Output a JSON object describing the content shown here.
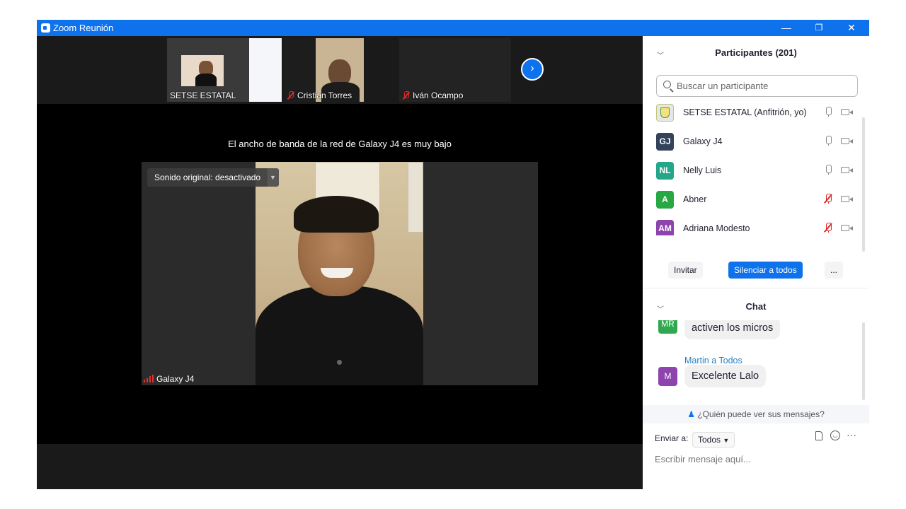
{
  "window": {
    "title": "Zoom Reunión",
    "minimize_glyph": "—",
    "restore_glyph": "❐",
    "close_glyph": "✕"
  },
  "thumbnails": [
    {
      "name": "SETSE ESTATAL",
      "muted": false
    },
    {
      "name": "Cristian Torres",
      "muted": true
    },
    {
      "name": "Iván Ocampo",
      "muted": true
    }
  ],
  "next_arrow": "›",
  "banner": "El ancho de banda de la red de Galaxy J4 es muy bajo",
  "main_video": {
    "sound_button": "Sonido original: desactivado",
    "name": "Galaxy J4"
  },
  "participants": {
    "header": "Participantes (201)",
    "search_placeholder": "Buscar un participante",
    "list": [
      {
        "initials": "",
        "name": "SETSE ESTATAL (Anfitrión, yo)",
        "color": "#e6e6e6",
        "mic_muted": false
      },
      {
        "initials": "GJ",
        "name": "Galaxy J4",
        "color": "#34435a",
        "mic_muted": false
      },
      {
        "initials": "NL",
        "name": "Nelly Luis",
        "color": "#23a78a",
        "mic_muted": false
      },
      {
        "initials": "A",
        "name": "Abner",
        "color": "#28a745",
        "mic_muted": true
      },
      {
        "initials": "AM",
        "name": "Adriana Modesto",
        "color": "#8e44ad",
        "mic_muted": true
      }
    ],
    "invite_label": "Invitar",
    "mute_all_label": "Silenciar a todos",
    "more_label": "..."
  },
  "chat": {
    "header": "Chat",
    "messages": [
      {
        "initials": "MR",
        "color": "#2fa84f",
        "text": "activen los micros"
      },
      {
        "initials": "M",
        "color": "#8e44ad",
        "sender": "Martin a Todos",
        "text": "Excelente Lalo"
      }
    ],
    "privacy_note": "¿Quién puede ver sus mensajes?",
    "send_to_label": "Enviar a:",
    "send_to_value": "Todos",
    "compose_placeholder": "Escribir mensaje aquí..."
  },
  "colors": {
    "accent": "#0e72ed",
    "muted_red": "#e02828"
  }
}
